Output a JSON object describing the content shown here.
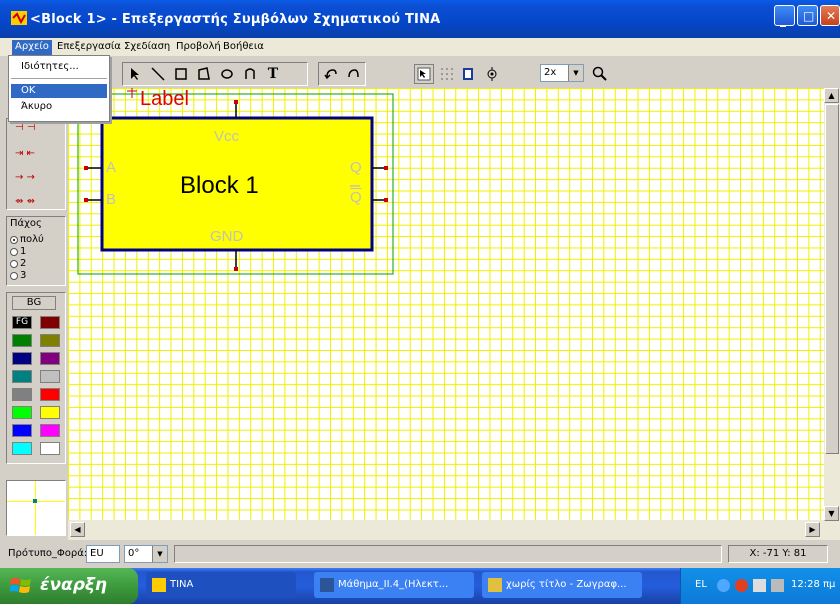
{
  "window": {
    "title": "<Block 1> - Επεξεργαστής Συμβόλων Σχηματικού TINA"
  },
  "menubar": {
    "items": [
      "Αρχείο",
      "Επεξεργασία",
      "Σχεδίαση",
      "Προβολή",
      "Βοήθεια"
    ]
  },
  "dropdown": {
    "items": [
      "Ιδιότητες...",
      "OK",
      "Άκυρο"
    ]
  },
  "toolbar": {
    "zoom": "2x"
  },
  "left_panel": {
    "thickness_title": "Πάχος",
    "thickness_options": [
      "πολύ",
      "1",
      "2",
      "3"
    ],
    "bg_label": "BG",
    "fg_label": "FG",
    "swatch_colors": [
      "#000000",
      "#800000",
      "#008000",
      "#808000",
      "#000080",
      "#800080",
      "#008080",
      "#c0c0c0",
      "#808080",
      "#ff0000",
      "#00ff00",
      "#ffff00",
      "#0000ff",
      "#ff00ff",
      "#00ffff",
      "#ffffff"
    ]
  },
  "canvas": {
    "label_text": "Label",
    "block_name": "Block 1",
    "pin_vcc": "Vcc",
    "pin_gnd": "GND",
    "pin_a": "A",
    "pin_b": "B",
    "pin_q": "Q",
    "pin_qbar": "Q",
    "block_color": "#ffff00",
    "grid_color": "#f0f000"
  },
  "statusbar": {
    "template_label": "Πρότυπο_Φορά:",
    "template_value": "EU",
    "angle_value": "0°",
    "coords": "X: -71  Y: 81"
  },
  "taskbar": {
    "start_label": "έναρξη",
    "tasks": [
      "TINA",
      "Μάθημα_II.4_(Ηλεκτ...",
      "χωρίς τίτλο - Ζωγραφ..."
    ],
    "lang": "EL",
    "clock": "12:28 πμ"
  }
}
